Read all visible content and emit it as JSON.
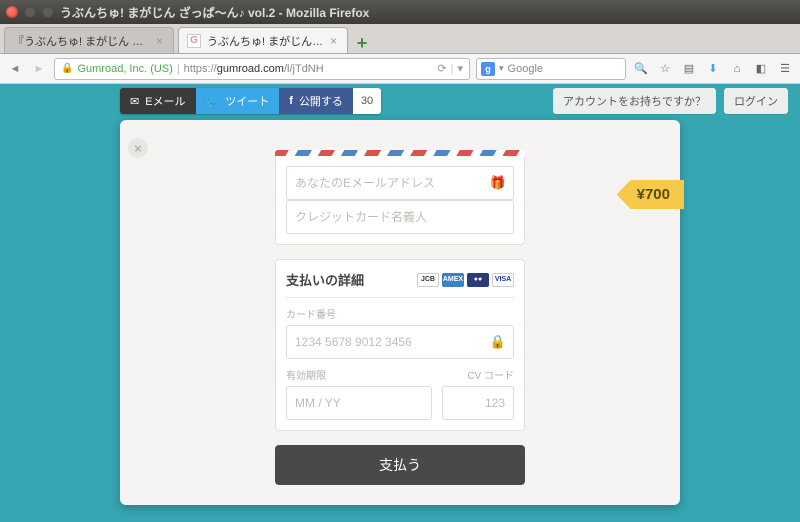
{
  "window": {
    "title": "うぶんちゅ! まがじん ざっぱ～ん♪ vol.2 - Mozilla Firefox"
  },
  "tabs": [
    {
      "label": "『うぶんちゅ! まがじん ざ…"
    },
    {
      "label": "うぶんちゅ! まがじん …"
    }
  ],
  "url": {
    "identity": "Gumroad, Inc. (US)",
    "scheme": "https://",
    "host": "gumroad.com",
    "path": "/l/jTdNH"
  },
  "search_placeholder": "Google",
  "share": {
    "mail": "Eメール",
    "tweet": "ツイート",
    "publish": "公開する",
    "count": "30"
  },
  "topbar": {
    "account_prompt": "アカウントをお持ちですか？",
    "login": "ログイン"
  },
  "price": "¥700",
  "form": {
    "email_placeholder": "あなたのEメールアドレス",
    "name_placeholder": "クレジットカード名義人",
    "pay_details_title": "支払いの詳細",
    "card_number_label": "カード番号",
    "card_number_placeholder": "1234 5678 9012 3456",
    "expiry_label": "有効期限",
    "expiry_placeholder": "MM / YY",
    "cvc_label": "CV コード",
    "cvc_placeholder": "123",
    "pay_button": "支払う"
  },
  "card_brands": {
    "jcb": "JCB",
    "amex": "AMEX",
    "mc": "●●",
    "visa": "VISA"
  }
}
